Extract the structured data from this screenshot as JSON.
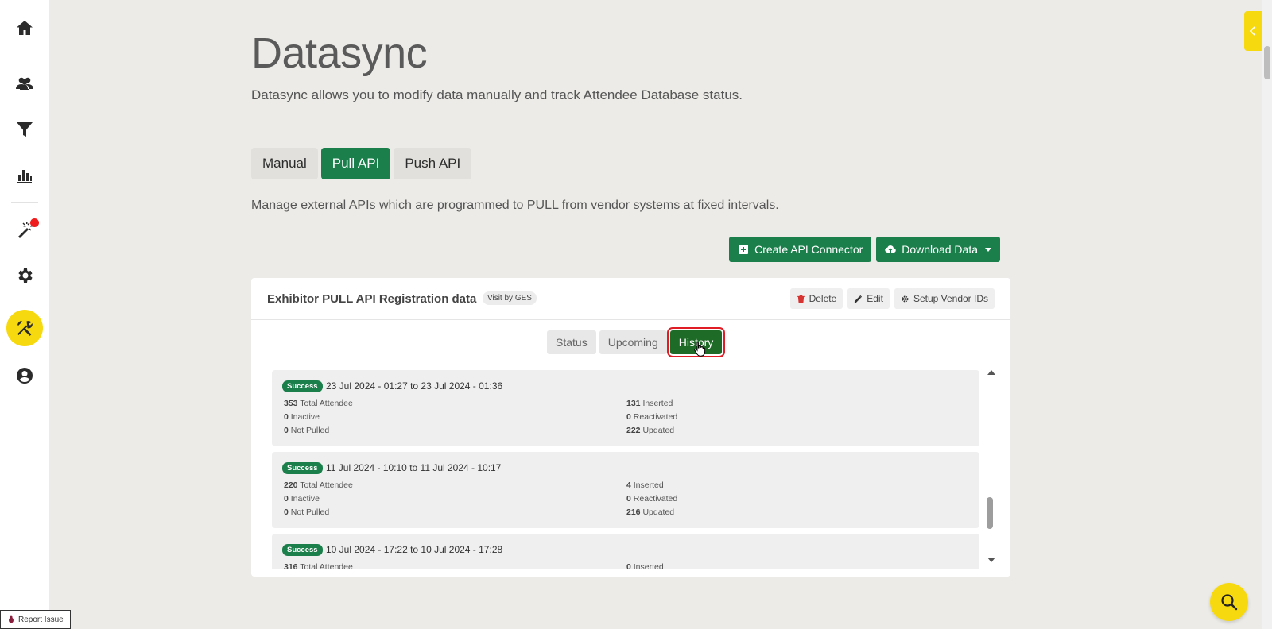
{
  "page": {
    "title": "Datasync",
    "subtitle": "Datasync allows you to modify data manually and track Attendee Database status."
  },
  "tabs": [
    {
      "label": "Manual",
      "active": false
    },
    {
      "label": "Pull API",
      "active": true
    },
    {
      "label": "Push API",
      "active": false
    }
  ],
  "tab_description": "Manage external APIs which are programmed to PULL from vendor systems at fixed intervals.",
  "actions": {
    "create_label": "Create API Connector",
    "download_label": "Download Data"
  },
  "card": {
    "title": "Exhibitor PULL API Registration data",
    "vendor_badge": "Visit by GES",
    "delete_label": "Delete",
    "edit_label": "Edit",
    "setup_label": "Setup Vendor IDs",
    "subtabs": [
      {
        "label": "Status",
        "active": false
      },
      {
        "label": "Upcoming",
        "active": false
      },
      {
        "label": "History",
        "active": true
      }
    ],
    "history": [
      {
        "status": "Success",
        "range": "23 Jul 2024 - 01:27 to 23 Jul 2024 - 01:36",
        "total": "353",
        "total_label": "Total Attendee",
        "inactive": "0",
        "inactive_label": "Inactive",
        "not_pulled": "0",
        "not_pulled_label": "Not Pulled",
        "inserted": "131",
        "inserted_label": "Inserted",
        "reactivated": "0",
        "reactivated_label": "Reactivated",
        "updated": "222",
        "updated_label": "Updated"
      },
      {
        "status": "Success",
        "range": "11 Jul 2024 - 10:10 to 11 Jul 2024 - 10:17",
        "total": "220",
        "total_label": "Total Attendee",
        "inactive": "0",
        "inactive_label": "Inactive",
        "not_pulled": "0",
        "not_pulled_label": "Not Pulled",
        "inserted": "4",
        "inserted_label": "Inserted",
        "reactivated": "0",
        "reactivated_label": "Reactivated",
        "updated": "216",
        "updated_label": "Updated"
      },
      {
        "status": "Success",
        "range": "10 Jul 2024 - 17:22 to 10 Jul 2024 - 17:28",
        "total": "316",
        "total_label": "Total Attendee",
        "inactive": "",
        "inactive_label": "",
        "not_pulled": "",
        "not_pulled_label": "",
        "inserted": "0",
        "inserted_label": "Inserted",
        "reactivated": "",
        "reactivated_label": "",
        "updated": "",
        "updated_label": ""
      }
    ]
  },
  "sidebar": {
    "items": [
      {
        "icon": "home-icon"
      },
      {
        "icon": "users-icon"
      },
      {
        "icon": "filter-icon"
      },
      {
        "icon": "bar-chart-icon"
      },
      {
        "icon": "magic-wand-icon",
        "notification": true
      },
      {
        "icon": "gear-icon"
      },
      {
        "icon": "tools-icon",
        "active": true
      },
      {
        "icon": "account-icon"
      }
    ]
  },
  "report_issue_label": "Report Issue",
  "colors": {
    "brand_green": "#1a7f4b",
    "accent_yellow": "#f7d90f",
    "history_active": "#1e6b28",
    "highlight_red": "#e01c24"
  }
}
